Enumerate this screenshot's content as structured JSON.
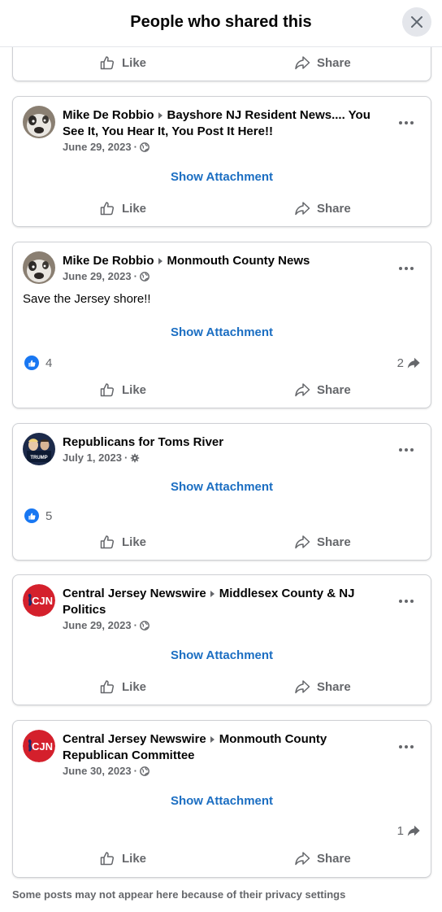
{
  "dialog": {
    "title": "People who shared this"
  },
  "labels": {
    "like": "Like",
    "share": "Share",
    "show_attachment": "Show Attachment",
    "sep": "·"
  },
  "posts": [
    {
      "author": "",
      "group": "",
      "date": ""
    },
    {
      "author": "Mike De Robbio",
      "group": "Bayshore NJ Resident News.... You See It, You Hear It, You Post It Here!!",
      "date": "June 29, 2023",
      "privacy": "public",
      "avatar": "dog"
    },
    {
      "author": "Mike De Robbio",
      "group": "Monmouth County News",
      "date": "June 29, 2023",
      "privacy": "public",
      "avatar": "dog",
      "text": "Save the Jersey shore!!",
      "likes": "4",
      "shares": "2"
    },
    {
      "author": "Republicans for Toms River",
      "date": "July 1, 2023",
      "privacy": "group",
      "avatar": "campaign-photo",
      "likes": "5"
    },
    {
      "author": "Central Jersey Newswire",
      "group": "Middlesex County & NJ Politics",
      "date": "June 29, 2023",
      "privacy": "public",
      "avatar": "cjn-logo"
    },
    {
      "author": "Central Jersey Newswire",
      "group": "Monmouth County Republican Committee",
      "date": "June 30, 2023",
      "privacy": "public",
      "avatar": "cjn-logo",
      "shares": "1"
    }
  ],
  "logo": {
    "cjn_text": "CJN",
    "cjn_color": "#d4202c",
    "trump_text": "TRUMP"
  },
  "colors": {
    "link": "#1b6ec2",
    "like_blue": "#1877f2",
    "secondary": "#65676b"
  },
  "footer": {
    "note": "Some posts may not appear here because of their privacy settings"
  }
}
